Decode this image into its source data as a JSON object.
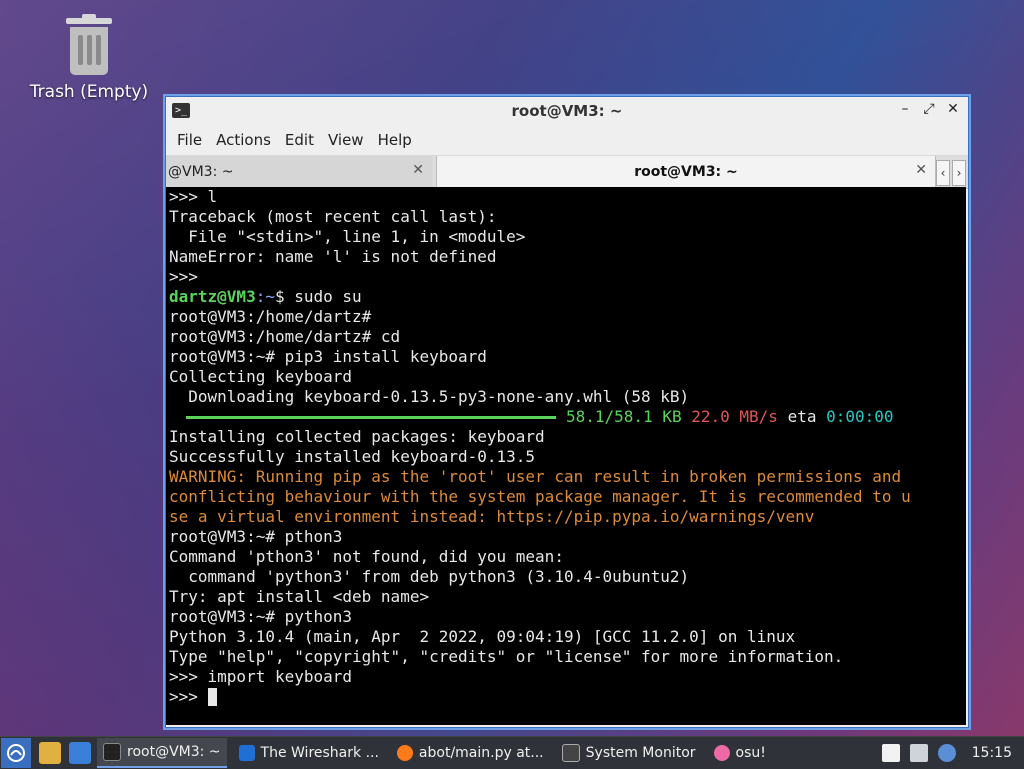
{
  "desktop": {
    "trash_label": "Trash (Empty)"
  },
  "window": {
    "title": "root@VM3: ~",
    "menu": [
      "File",
      "Actions",
      "Edit",
      "View",
      "Help"
    ],
    "tabs": [
      {
        "label": "@VM3: ~",
        "active": false
      },
      {
        "label": "root@VM3: ~",
        "active": true
      }
    ]
  },
  "terminal": {
    "lines": {
      "l1": ">>> l",
      "l2": "Traceback (most recent call last):",
      "l3": "  File \"<stdin>\", line 1, in <module>",
      "l4": "NameError: name 'l' is not defined",
      "l5": ">>>",
      "l6_user": "dartz@VM3",
      "l6_path": ":~",
      "l6_cmd": "$ sudo su",
      "l7": "root@VM3:/home/dartz#",
      "l8": "root@VM3:/home/dartz# cd",
      "l9": "root@VM3:~# pip3 install keyboard",
      "l10": "Collecting keyboard",
      "l11": "  Downloading keyboard-0.13.5-py3-none-any.whl (58 kB)",
      "progress_size": "58.1/58.1 KB",
      "progress_speed": "22.0 MB/s",
      "progress_eta_label": "eta",
      "progress_eta": "0:00:00",
      "l13": "Installing collected packages: keyboard",
      "l14": "Successfully installed keyboard-0.13.5",
      "l15": "WARNING: Running pip as the 'root' user can result in broken permissions and",
      "l16": "conflicting behaviour with the system package manager. It is recommended to u",
      "l17": "se a virtual environment instead: https://pip.pypa.io/warnings/venv",
      "l18": "root@VM3:~# pthon3",
      "l19": "Command 'pthon3' not found, did you mean:",
      "l20": "  command 'python3' from deb python3 (3.10.4-0ubuntu2)",
      "l21": "Try: apt install <deb name>",
      "l22": "root@VM3:~# python3",
      "l23": "Python 3.10.4 (main, Apr  2 2022, 09:04:19) [GCC 11.2.0] on linux",
      "l24": "Type \"help\", \"copyright\", \"credits\" or \"license\" for more information.",
      "l25": ">>> import keyboard",
      "l26": ">>> "
    }
  },
  "taskbar": {
    "items": [
      {
        "label": "root@VM3: ~",
        "icon": "terminal-icon"
      },
      {
        "label": "The Wireshark ...",
        "icon": "wireshark-icon"
      },
      {
        "label": "abot/main.py at...",
        "icon": "firefox-icon"
      },
      {
        "label": "System Monitor",
        "icon": "system-monitor-icon"
      },
      {
        "label": "osu!",
        "icon": "osu-icon"
      }
    ],
    "clock": "15:15"
  },
  "colors": {
    "accent": "#3a6fc0",
    "prompt_green": "#5ad35a",
    "warning_orange": "#dd8a3a"
  }
}
